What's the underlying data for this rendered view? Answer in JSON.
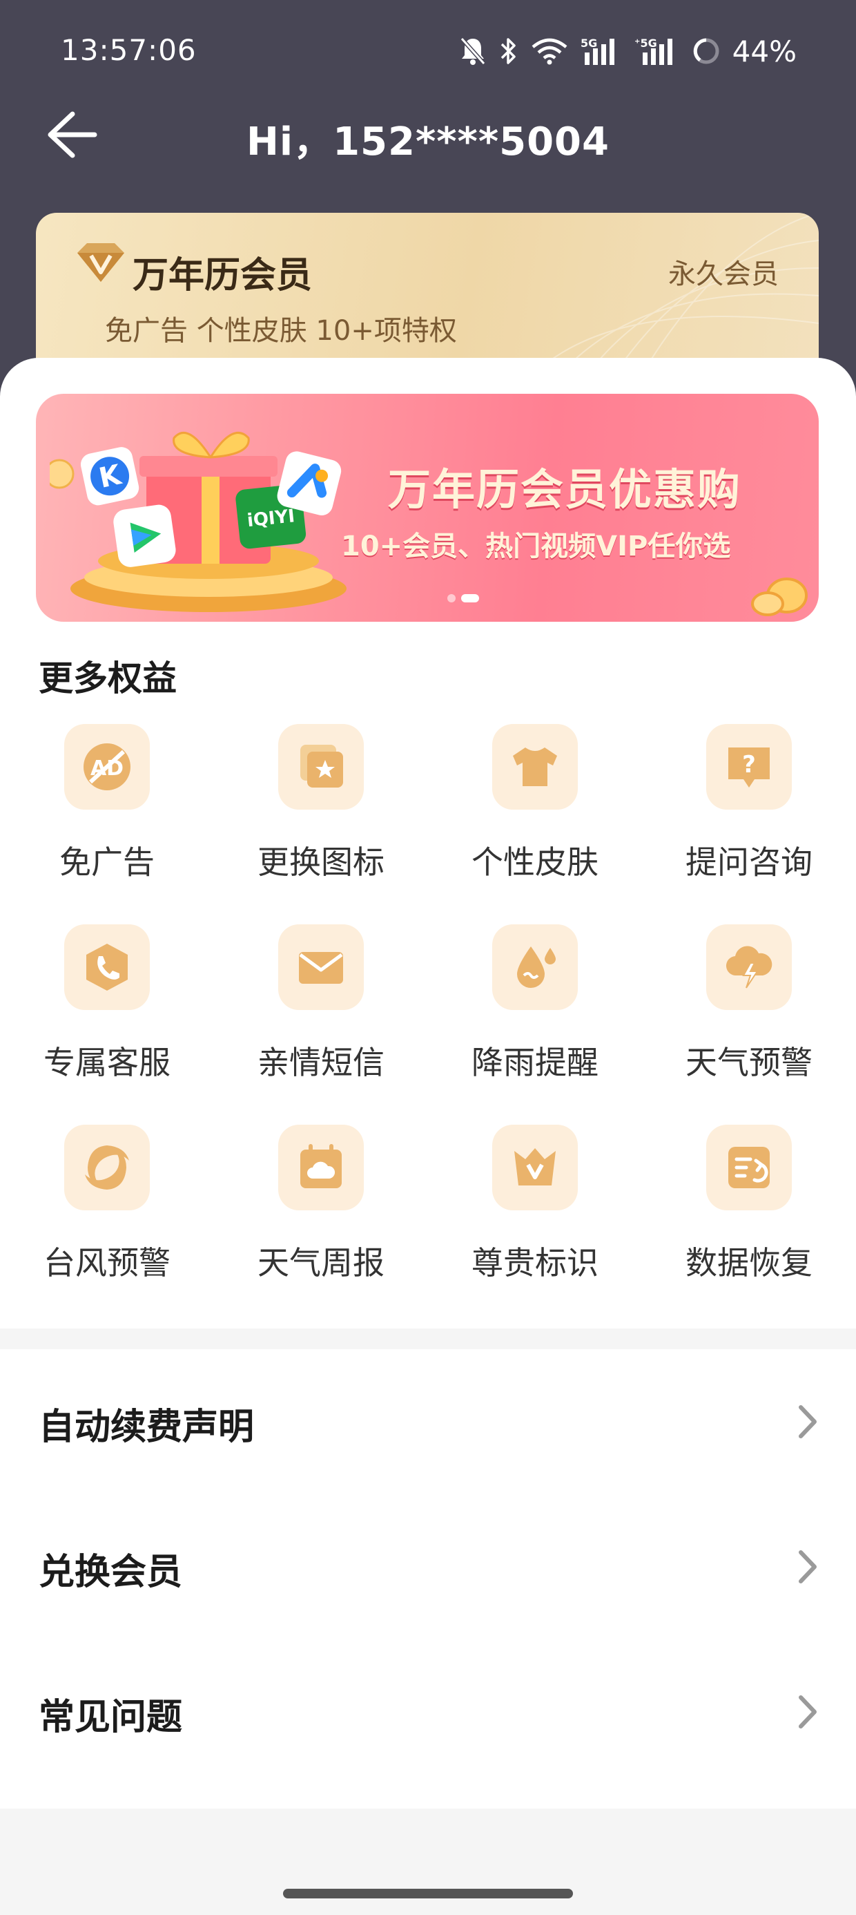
{
  "status_bar": {
    "time": "13:57:06",
    "battery": "44%",
    "icons": [
      "mute-icon",
      "bluetooth-icon",
      "wifi-icon",
      "5g-signal-icon",
      "5g-signal-icon",
      "battery-icon"
    ]
  },
  "header": {
    "title": "Hi，152****5004",
    "back_icon": "arrow-left-icon"
  },
  "member_card": {
    "title": "万年历会员",
    "type": "永久会员",
    "description": "免广告 个性皮肤 10+项特权",
    "badge_icon": "vip-diamond-icon"
  },
  "banner": {
    "title": "万年历会员优惠购",
    "subtitle": "10+会员、热门视频VIP任你选",
    "active_slide": 2,
    "slide_count": 2
  },
  "benefits": {
    "section_title": "更多权益",
    "items": [
      {
        "label": "免广告",
        "icon": "no-ad-icon"
      },
      {
        "label": "更换图标",
        "icon": "change-icon-icon"
      },
      {
        "label": "个性皮肤",
        "icon": "tshirt-icon"
      },
      {
        "label": "提问咨询",
        "icon": "question-bubble-icon"
      },
      {
        "label": "专属客服",
        "icon": "phone-icon"
      },
      {
        "label": "亲情短信",
        "icon": "envelope-icon"
      },
      {
        "label": "降雨提醒",
        "icon": "raindrop-icon"
      },
      {
        "label": "天气预警",
        "icon": "thunder-cloud-icon"
      },
      {
        "label": "台风预警",
        "icon": "typhoon-icon"
      },
      {
        "label": "天气周报",
        "icon": "weather-calendar-icon"
      },
      {
        "label": "尊贵标识",
        "icon": "crown-icon"
      },
      {
        "label": "数据恢复",
        "icon": "data-restore-icon"
      }
    ]
  },
  "menu": {
    "items": [
      {
        "label": "自动续费声明"
      },
      {
        "label": "兑换会员"
      },
      {
        "label": "常见问题"
      }
    ]
  },
  "colors": {
    "header_bg": "#484655",
    "icon_bg": "#fdeedb",
    "icon_fg": "#eab36b",
    "banner_pink": "#ff8c9b"
  }
}
